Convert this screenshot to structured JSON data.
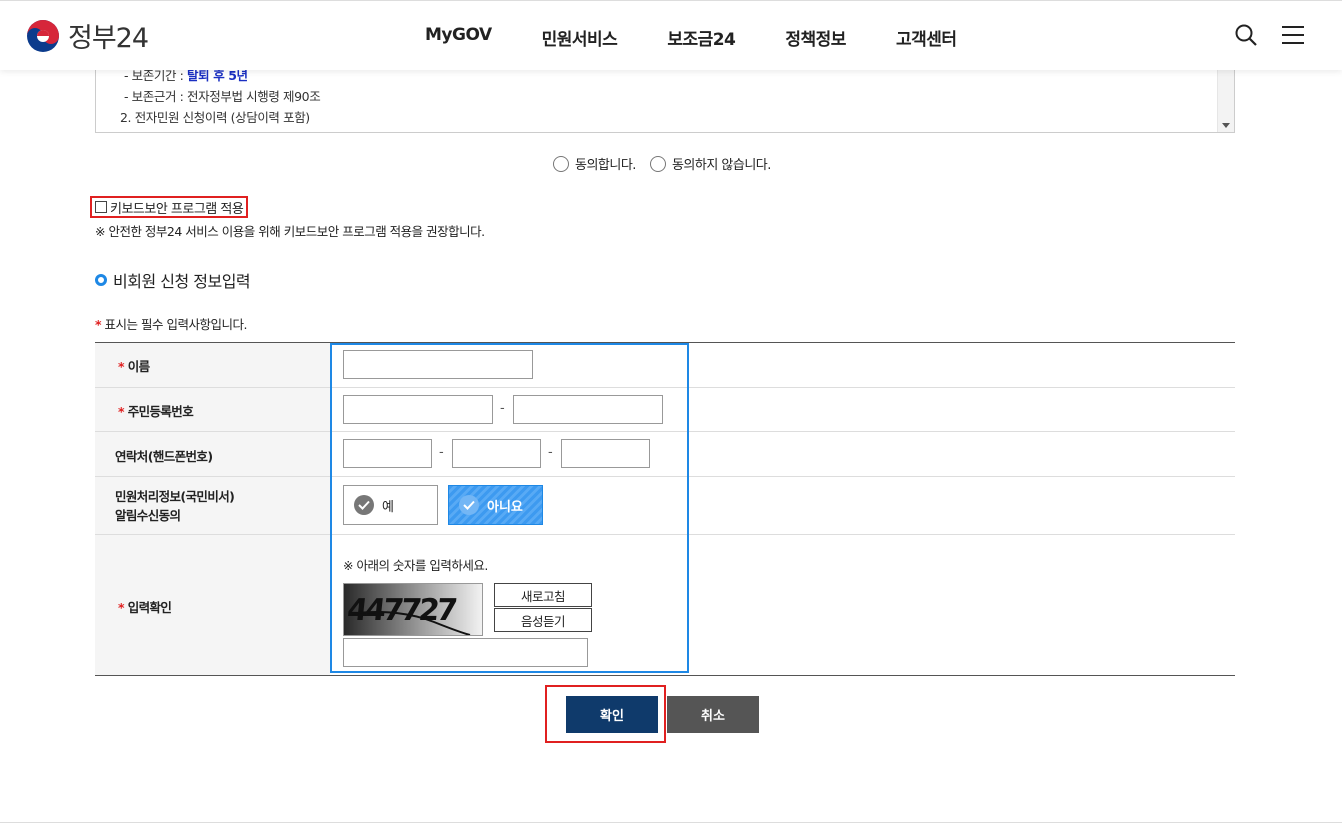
{
  "header": {
    "logo_text": "정부24",
    "nav": [
      "MyGOV",
      "민원서비스",
      "보조금24",
      "정책정보",
      "고객센터"
    ],
    "icons": [
      "search-icon",
      "menu-icon"
    ]
  },
  "terms": {
    "line1_prefix": "- 보존기간 : ",
    "line1_value": "탈퇴 후 5년",
    "line2": "- 보존근거 : 전자정부법 시행령 제90조",
    "line3": "2. 전자민원 신청이력 (상담이력 포함)"
  },
  "consent": {
    "agree": "동의합니다.",
    "disagree": "동의하지 않습니다."
  },
  "keyboard": {
    "label": "키보드보안 프로그램 적용",
    "note": "※ 안전한 정부24 서비스 이용을 위해 키보드보안 프로그램 적용을 권장합니다."
  },
  "section": {
    "title": "비회원 신청 정보입력",
    "required_note": "표시는 필수 입력사항입니다."
  },
  "form": {
    "name_label": "이름",
    "rrn_label": "주민등록번호",
    "phone_label": "연락처(핸드폰번호)",
    "notice_label_line1": "민원처리정보(국민비서)",
    "notice_label_line2": "알림수신동의",
    "captcha_label": "입력확인",
    "yes": "예",
    "no": "아니요",
    "captcha_note": "※ 아래의 숫자를 입력하세요.",
    "refresh": "새로고침",
    "audio": "음성듣기",
    "captcha_value": "447727",
    "dash": "-",
    "star": "*"
  },
  "actions": {
    "confirm": "확인",
    "cancel": "취소"
  },
  "colors": {
    "accent": "#1e88e5",
    "confirm": "#0f3a6b",
    "highlight_box": "#e02020"
  }
}
